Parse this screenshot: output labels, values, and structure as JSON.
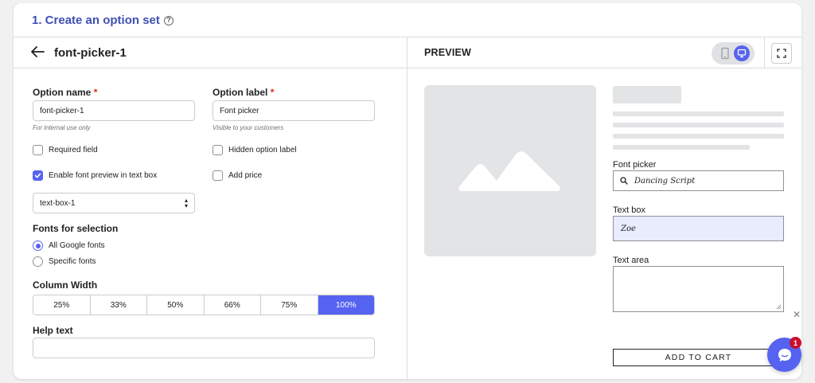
{
  "section_title": "1. Create an option set",
  "header": {
    "set_name": "font-picker-1",
    "preview_title": "PREVIEW"
  },
  "form": {
    "option_name": {
      "label": "Option name",
      "required_mark": "*",
      "value": "font-picker-1",
      "hint": "For internal use only"
    },
    "option_label": {
      "label": "Option label",
      "required_mark": "*",
      "value": "Font picker",
      "hint": "Visible to your customers"
    },
    "checkboxes": [
      {
        "label": "Required field",
        "checked": false
      },
      {
        "label": "Hidden option label",
        "checked": false
      },
      {
        "label": "Enable font preview in text box",
        "checked": true
      },
      {
        "label": "Add price",
        "checked": false
      }
    ],
    "text_box_select": {
      "value": "text-box-1"
    },
    "fonts_for_selection": {
      "label": "Fonts for selection",
      "options": [
        {
          "label": "All Google fonts",
          "checked": true
        },
        {
          "label": "Specific fonts",
          "checked": false
        }
      ]
    },
    "column_width": {
      "label": "Column Width",
      "options": [
        "25%",
        "33%",
        "50%",
        "66%",
        "75%",
        "100%"
      ],
      "selected": "100%"
    },
    "help_text": {
      "label": "Help text",
      "value": ""
    }
  },
  "preview": {
    "font_picker": {
      "label": "Font picker",
      "value": "Dancing Script"
    },
    "text_box": {
      "label": "Text box",
      "value": "Zoe"
    },
    "text_area": {
      "label": "Text area",
      "value": ""
    },
    "add_to_cart": "ADD TO CART"
  },
  "chat": {
    "badge_count": "1"
  },
  "colors": {
    "accent": "#5663f0",
    "title": "#3f4fb3",
    "required": "#d72c0d",
    "text_box_fill": "#e8ecfd",
    "badge": "#c8102e"
  }
}
